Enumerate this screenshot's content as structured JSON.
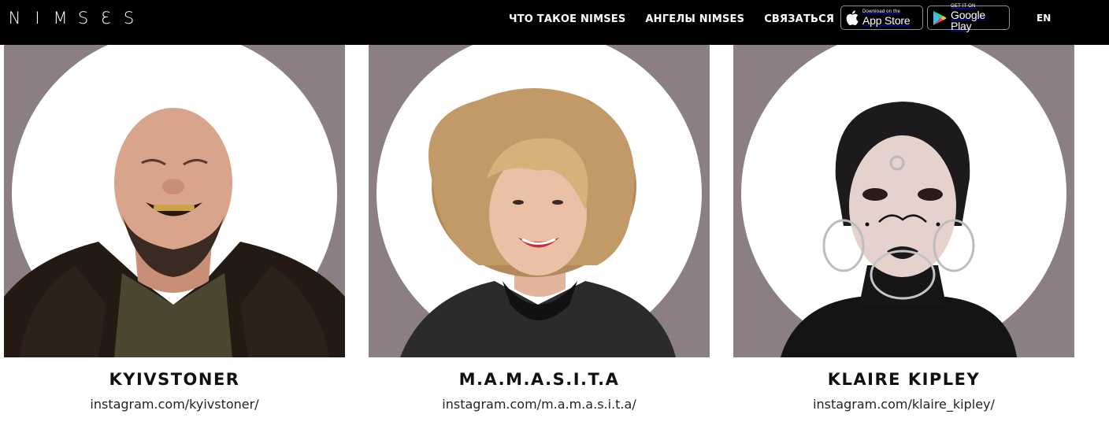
{
  "header": {
    "logo_letters": [
      "N",
      "I",
      "M",
      "S",
      "Ɛ",
      "S"
    ],
    "nav": [
      {
        "label": "ЧТО ТАКОЕ NIMSES"
      },
      {
        "label": "АНГЕЛЫ NIMSES"
      },
      {
        "label": "СВЯЗАТЬСЯ"
      }
    ],
    "app_store": {
      "small": "Download on the",
      "big": "App Store",
      "icon": "apple-icon"
    },
    "google_play": {
      "small": "GET IT ON",
      "big": "Google Play",
      "icon": "google-play-icon"
    },
    "language": "EN"
  },
  "angels": [
    {
      "name": "KYIVSTONER",
      "link": "instagram.com/kyivstoner/"
    },
    {
      "name": "M.A.M.A.S.I.T.A",
      "link": "instagram.com/m.a.m.a.s.i.t.a/"
    },
    {
      "name": "KLAIRE KIPLEY",
      "link": "instagram.com/klaire_kipley/"
    }
  ],
  "colors": {
    "header_bg": "#000000",
    "photo_bg": "#8b7f84",
    "text": "#111111"
  }
}
